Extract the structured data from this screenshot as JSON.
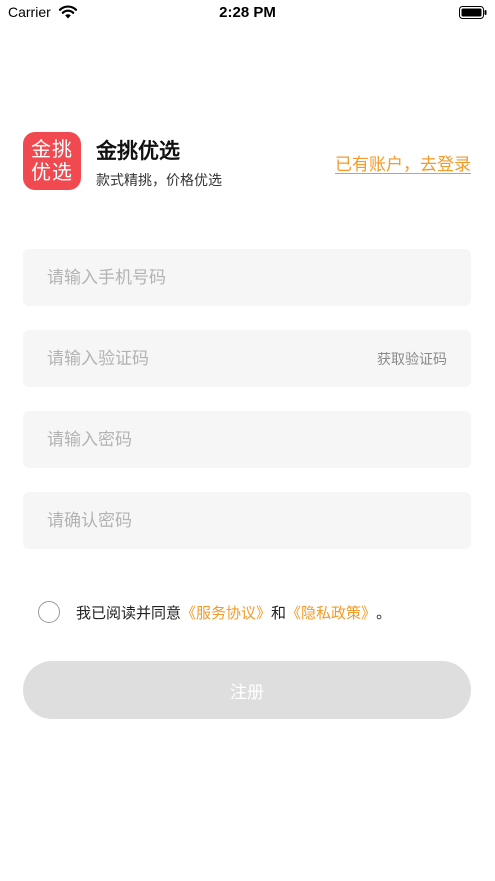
{
  "status_bar": {
    "carrier": "Carrier",
    "time": "2:28 PM"
  },
  "brand": {
    "logo_line1": "金挑",
    "logo_line2": "优选",
    "name": "金挑优选",
    "slogan": "款式精挑，价格优选",
    "logo_color": "#f0494f"
  },
  "header": {
    "login_link": "已有账户，去登录"
  },
  "form": {
    "phone_placeholder": "请输入手机号码",
    "code_placeholder": "请输入验证码",
    "get_code_label": "获取验证码",
    "password_placeholder": "请输入密码",
    "confirm_placeholder": "请确认密码"
  },
  "agreement": {
    "prefix": "我已阅读并同意",
    "service_link": "《服务协议》",
    "conjunction": "和",
    "privacy_link": "《隐私政策》",
    "suffix": "。",
    "accent_color": "#f39a28"
  },
  "register_button": {
    "label": "注册"
  }
}
